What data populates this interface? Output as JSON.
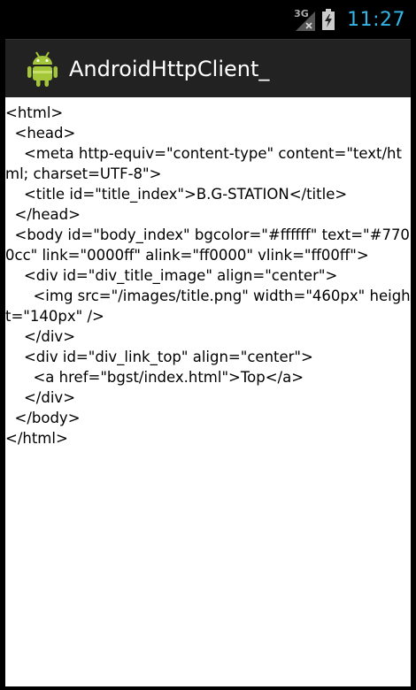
{
  "status_bar": {
    "network_type": "3G",
    "time": "11:27",
    "icons": [
      "3g-signal-icon",
      "battery-charging-icon"
    ]
  },
  "action_bar": {
    "app_icon": "android-robot-icon",
    "title": "AndroidHttpClient_"
  },
  "content": {
    "lines": [
      "<html>",
      "  <head>",
      "    <meta http-equiv=\"content-type\" content=\"text/html; charset=UTF-8\">",
      "    <title id=\"title_index\">B.G-STATION</title>",
      "  </head>",
      "  <body id=\"body_index\" bgcolor=\"#ffffff\" text=\"#7700cc\" link=\"0000ff\" alink=\"ff0000\" vlink=\"ff00ff\">",
      "    <div id=\"div_title_image\" align=\"center\">",
      "      <img src=\"/images/title.png\" width=\"460px\" height=\"140px\" />",
      "    </div>",
      "    <div id=\"div_link_top\" align=\"center\">",
      "      <a href=\"bgst/index.html\">Top</a>",
      "    </div>",
      "  </body>",
      "</html>"
    ]
  },
  "colors": {
    "clock": "#33b5e5",
    "action_bar_bg": "#222222",
    "android_green": "#a4c639"
  }
}
